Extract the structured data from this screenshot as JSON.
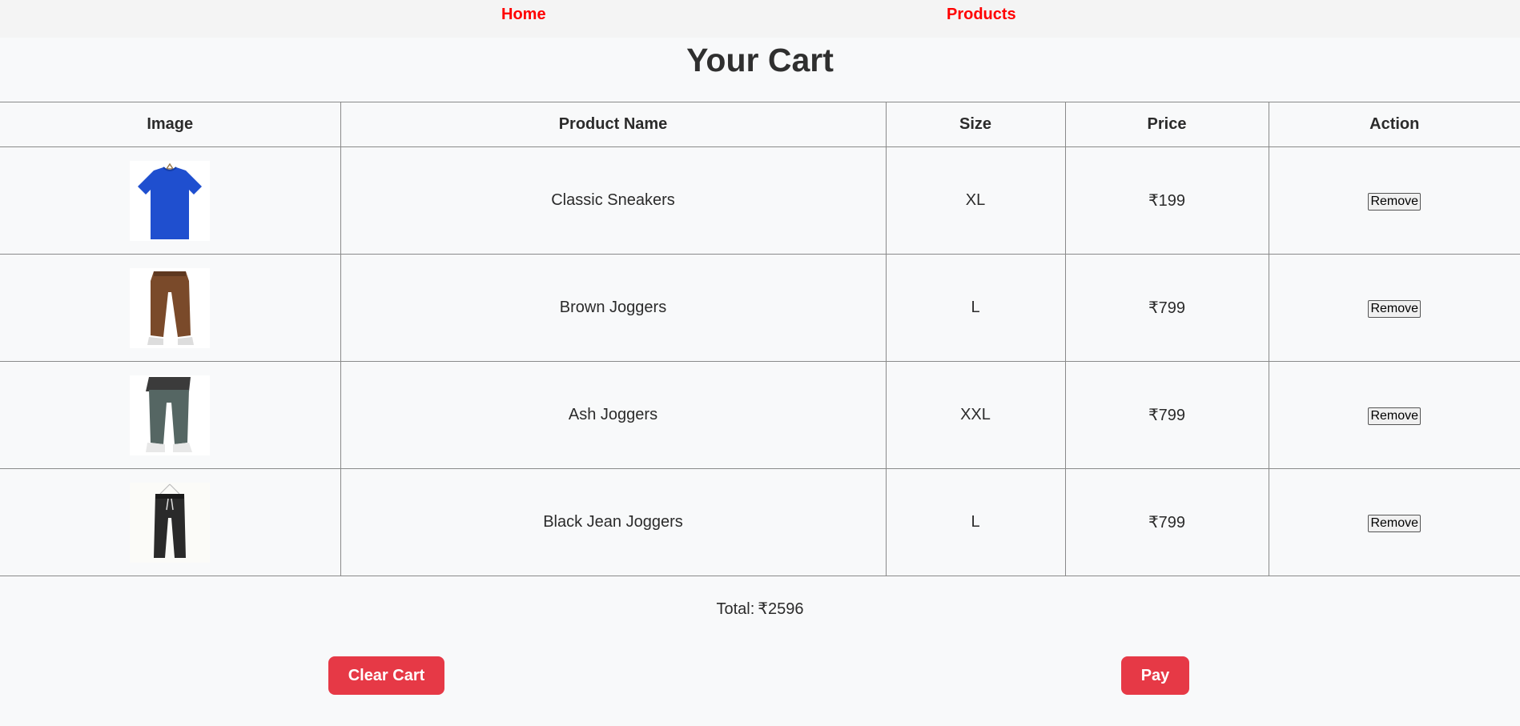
{
  "nav": {
    "home_label": "Home",
    "products_label": "Products"
  },
  "page_title": "Your Cart",
  "table": {
    "headers": [
      "Image",
      "Product Name",
      "Size",
      "Price",
      "Action"
    ],
    "rows": [
      {
        "image_icon": "blue-tshirt",
        "name": "Classic Sneakers",
        "size": "XL",
        "price": "₹199",
        "action": "Remove"
      },
      {
        "image_icon": "brown-joggers",
        "name": "Brown Joggers",
        "size": "L",
        "price": "₹799",
        "action": "Remove"
      },
      {
        "image_icon": "ash-joggers",
        "name": "Ash Joggers",
        "size": "XXL",
        "price": "₹799",
        "action": "Remove"
      },
      {
        "image_icon": "black-joggers",
        "name": "Black Jean Joggers",
        "size": "L",
        "price": "₹799",
        "action": "Remove"
      }
    ]
  },
  "total": {
    "label": "Total:",
    "value": "₹2596"
  },
  "buttons": {
    "clear_label": "Clear Cart",
    "pay_label": "Pay"
  },
  "colors": {
    "accent": "#e63946",
    "nav_link": "#ff0000",
    "background": "#f8f9fa"
  }
}
